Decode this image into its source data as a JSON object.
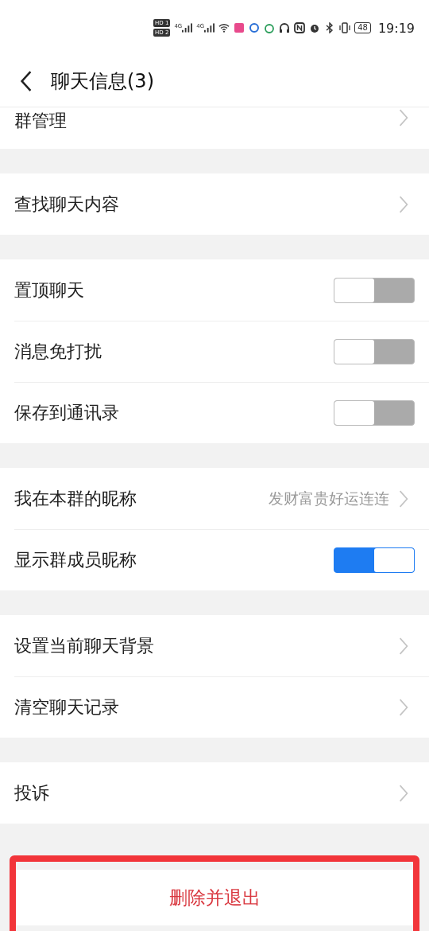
{
  "status_bar": {
    "sim_labels": [
      "HD 1",
      "HD 2"
    ],
    "network_labels": [
      "4G",
      "4G"
    ],
    "battery": "48",
    "time": "19:19"
  },
  "header": {
    "title": "聊天信息(3)"
  },
  "sections": [
    {
      "rows": [
        {
          "kind": "link",
          "label": "群管理",
          "cut": true
        }
      ]
    },
    {
      "rows": [
        {
          "kind": "link",
          "label": "查找聊天内容"
        }
      ]
    },
    {
      "rows": [
        {
          "kind": "toggle",
          "label": "置顶聊天",
          "on": false
        },
        {
          "kind": "toggle",
          "label": "消息免打扰",
          "on": false
        },
        {
          "kind": "toggle",
          "label": "保存到通讯录",
          "on": false
        }
      ]
    },
    {
      "rows": [
        {
          "kind": "link",
          "label": "我在本群的昵称",
          "value": "发财富贵好运连连"
        },
        {
          "kind": "toggle",
          "label": "显示群成员昵称",
          "on": true
        }
      ]
    },
    {
      "rows": [
        {
          "kind": "link",
          "label": "设置当前聊天背景"
        },
        {
          "kind": "link",
          "label": "清空聊天记录"
        }
      ]
    },
    {
      "rows": [
        {
          "kind": "link",
          "label": "投诉"
        }
      ]
    }
  ],
  "delete_action": {
    "label": "删除并退出",
    "highlighted": true
  }
}
